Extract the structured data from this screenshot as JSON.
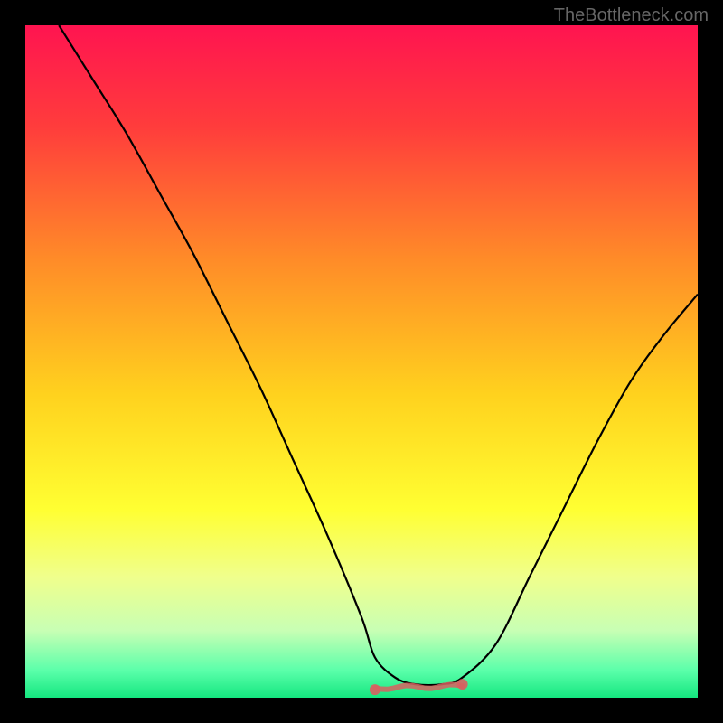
{
  "watermark": "TheBottleneck.com",
  "chart_data": {
    "type": "line",
    "title": "",
    "xlabel": "",
    "ylabel": "",
    "xlim": [
      0,
      100
    ],
    "ylim": [
      0,
      100
    ],
    "background_gradient": {
      "stops": [
        {
          "offset": 0,
          "color": "#ff1450"
        },
        {
          "offset": 15,
          "color": "#ff3c3c"
        },
        {
          "offset": 35,
          "color": "#ff8c28"
        },
        {
          "offset": 55,
          "color": "#ffd21e"
        },
        {
          "offset": 72,
          "color": "#ffff32"
        },
        {
          "offset": 82,
          "color": "#f0ff8c"
        },
        {
          "offset": 90,
          "color": "#c8ffb4"
        },
        {
          "offset": 96,
          "color": "#5affaa"
        },
        {
          "offset": 100,
          "color": "#14e67f"
        }
      ]
    },
    "series": [
      {
        "name": "curve",
        "color": "#000000",
        "x": [
          5,
          10,
          15,
          20,
          25,
          30,
          35,
          40,
          45,
          50,
          52,
          55,
          58,
          62,
          65,
          70,
          75,
          80,
          85,
          90,
          95,
          100
        ],
        "y": [
          100,
          92,
          84,
          75,
          66,
          56,
          46,
          35,
          24,
          12,
          6,
          3,
          2,
          2,
          3,
          8,
          18,
          28,
          38,
          47,
          54,
          60
        ]
      }
    ],
    "highlight": {
      "name": "bottom-highlight",
      "color": "#d86060",
      "x_range": [
        52,
        65
      ],
      "y": 2
    }
  }
}
